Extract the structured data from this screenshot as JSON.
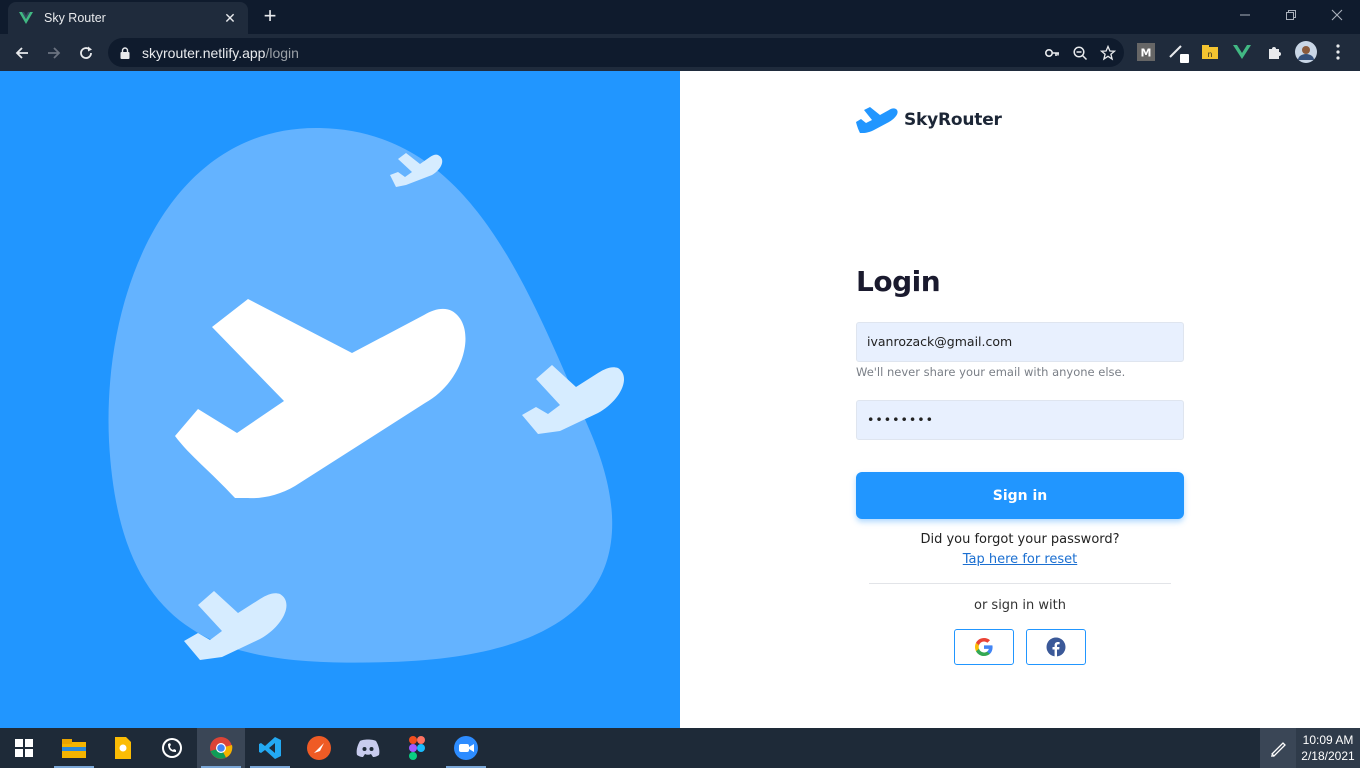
{
  "browser": {
    "tab_title": "Sky Router",
    "new_tab_label": "+",
    "url_host": "skyrouter.netlify.app",
    "url_path": "/login",
    "extensions": [
      "medium-extension-icon",
      "pen-extension-icon",
      "folder-extension-icon",
      "vue-devtools-icon",
      "extensions-puzzle-icon",
      "profile-avatar",
      "menu-kebab-icon"
    ]
  },
  "brand": {
    "name": "SkyRouter"
  },
  "login": {
    "title": "Login",
    "email_value": "ivanrozack@gmail.com",
    "email_helper": "We'll never share your email with anyone else.",
    "password_value": "••••••••",
    "signin_label": "Sign in",
    "forgot_text": "Did you forgot your password?",
    "reset_link": "Tap here for reset",
    "social_text": "or sign in with"
  },
  "colors": {
    "primary": "#2196ff",
    "blob": "#64b3ff",
    "small_planes": "#d6ecff"
  },
  "taskbar": {
    "apps": [
      "windows-start",
      "file-explorer",
      "google-keep",
      "whatsapp",
      "chrome",
      "vs-code",
      "postman",
      "discord",
      "figma",
      "zoom"
    ],
    "time": "10:09 AM",
    "date": "2/18/2021"
  }
}
